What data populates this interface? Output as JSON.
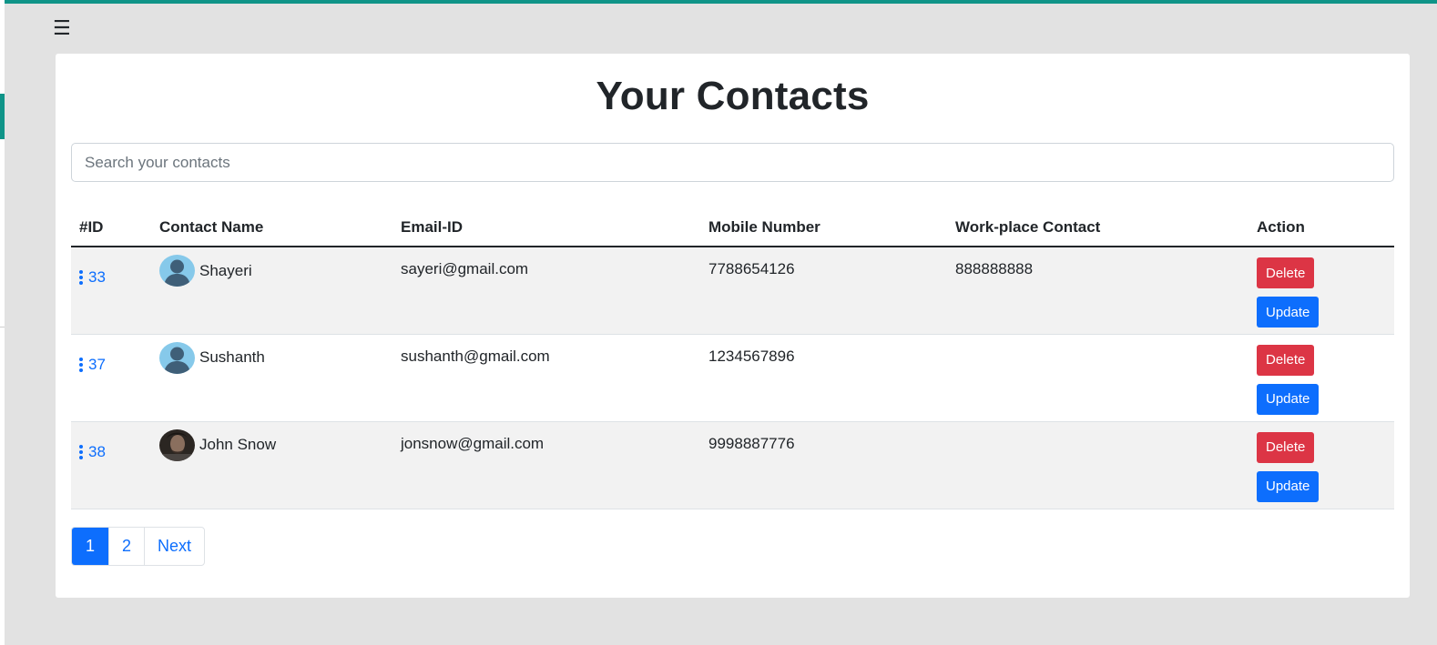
{
  "header": {
    "menu_icon": "hamburger-icon"
  },
  "page": {
    "title": "Your Contacts"
  },
  "search": {
    "placeholder": "Search your contacts",
    "value": ""
  },
  "table": {
    "columns": [
      "#ID",
      "Contact Name",
      "Email-ID",
      "Mobile Number",
      "Work-place Contact",
      "Action"
    ],
    "rows": [
      {
        "id": "33",
        "name": "Shayeri",
        "email": "sayeri@gmail.com",
        "mobile": "7788654126",
        "work": "888888888",
        "avatar": "default-avatar"
      },
      {
        "id": "37",
        "name": "Sushanth",
        "email": "sushanth@gmail.com",
        "mobile": "1234567896",
        "work": "",
        "avatar": "default-avatar"
      },
      {
        "id": "38",
        "name": "John Snow",
        "email": "jonsnow@gmail.com",
        "mobile": "9998887776",
        "work": "",
        "avatar": "photo-avatar"
      }
    ],
    "delete_label": "Delete",
    "update_label": "Update"
  },
  "pagination": {
    "pages": [
      "1",
      "2"
    ],
    "active": "1",
    "next_label": "Next"
  },
  "colors": {
    "accent": "#0f9488",
    "primary": "#0d6efd",
    "danger": "#dc3545"
  }
}
